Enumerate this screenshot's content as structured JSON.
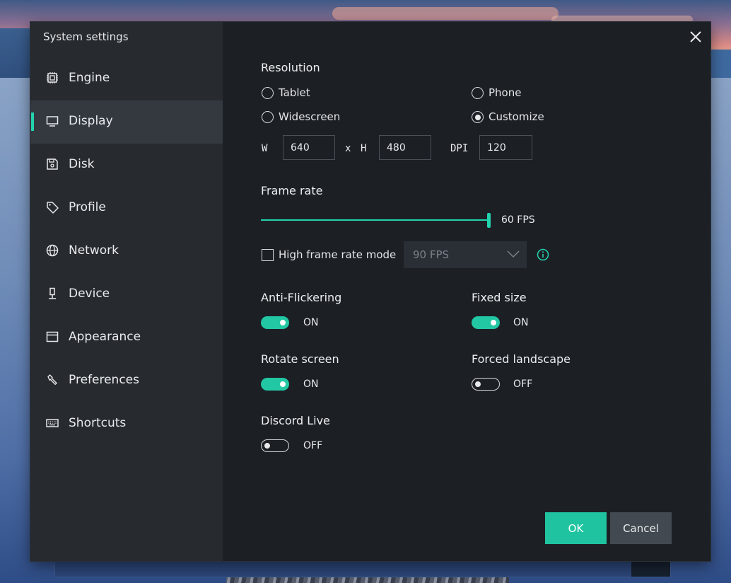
{
  "sidebar": {
    "title": "System settings",
    "items": [
      {
        "label": "Engine",
        "icon": "cpu-icon"
      },
      {
        "label": "Display",
        "icon": "monitor-icon",
        "active": true
      },
      {
        "label": "Disk",
        "icon": "disk-icon"
      },
      {
        "label": "Profile",
        "icon": "tag-icon"
      },
      {
        "label": "Network",
        "icon": "globe-icon"
      },
      {
        "label": "Device",
        "icon": "microphone-icon"
      },
      {
        "label": "Appearance",
        "icon": "window-icon"
      },
      {
        "label": "Preferences",
        "icon": "wrench-icon"
      },
      {
        "label": "Shortcuts",
        "icon": "keyboard-icon"
      }
    ]
  },
  "display": {
    "resolution": {
      "label": "Resolution",
      "options": [
        {
          "label": "Tablet",
          "checked": false
        },
        {
          "label": "Phone",
          "checked": false
        },
        {
          "label": "Widescreen",
          "checked": false
        },
        {
          "label": "Customize",
          "checked": true
        }
      ],
      "w_label": "W",
      "x_label": "x",
      "h_label": "H",
      "dpi_label": "DPI",
      "width": "640",
      "height": "480",
      "dpi": "120"
    },
    "frame_rate": {
      "label": "Frame rate",
      "value": "60 FPS",
      "slider_fraction": 1.0,
      "high_mode_label": "High frame rate mode",
      "high_mode_checked": false,
      "high_mode_select": "90 FPS"
    },
    "toggles": {
      "anti_flickering": {
        "label": "Anti-Flickering",
        "state": "ON"
      },
      "fixed_size": {
        "label": "Fixed size",
        "state": "ON"
      },
      "rotate_screen": {
        "label": "Rotate screen",
        "state": "ON"
      },
      "forced_landscape": {
        "label": "Forced landscape",
        "state": "OFF"
      },
      "discord_live": {
        "label": "Discord Live",
        "state": "OFF"
      }
    }
  },
  "footer": {
    "ok": "OK",
    "cancel": "Cancel"
  },
  "colors": {
    "accent": "#22d3ae",
    "dialog_bg": "#1c2025",
    "sidebar_bg": "#272b30"
  }
}
